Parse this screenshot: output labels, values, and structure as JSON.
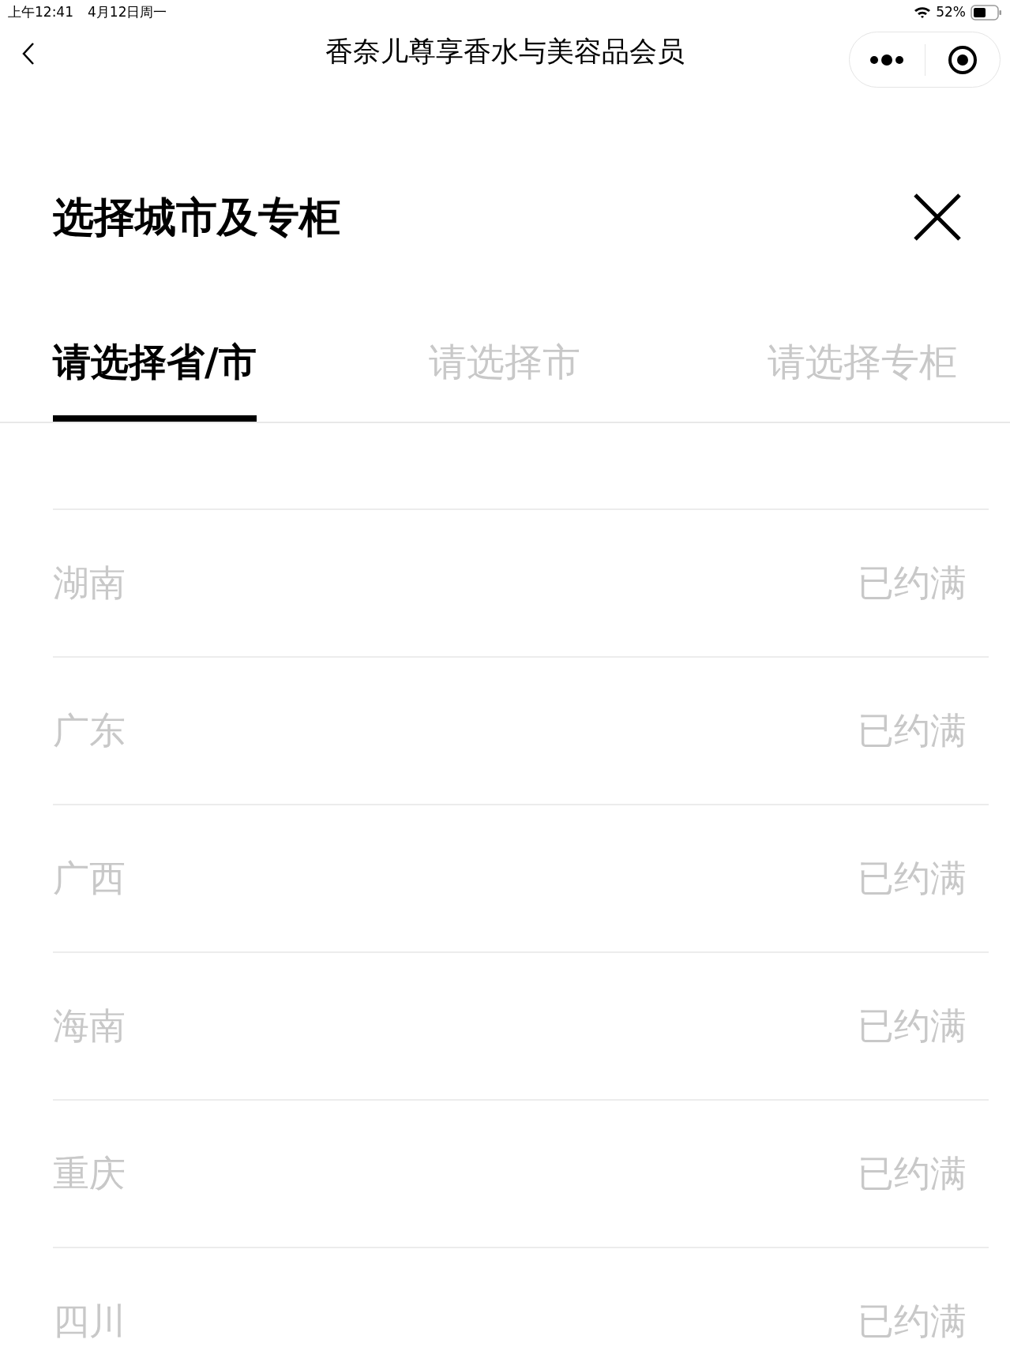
{
  "status_bar": {
    "time": "上午12:41",
    "date": "4月12日周一",
    "battery": "52%"
  },
  "nav": {
    "title": "香奈儿尊享香水与美容品会员"
  },
  "panel": {
    "title": "选择城市及专柜"
  },
  "tabs": [
    {
      "label": "请选择省/市",
      "selected": true
    },
    {
      "label": "请选择市",
      "selected": false
    },
    {
      "label": "请选择专柜",
      "selected": false
    }
  ],
  "provinces": [
    {
      "name": "湖南",
      "status": "已约满",
      "disabled": true
    },
    {
      "name": "广东",
      "status": "已约满",
      "disabled": true
    },
    {
      "name": "广西",
      "status": "已约满",
      "disabled": true
    },
    {
      "name": "海南",
      "status": "已约满",
      "disabled": true
    },
    {
      "name": "重庆",
      "status": "已约满",
      "disabled": true
    },
    {
      "name": "四川",
      "status": "已约满",
      "disabled": true
    }
  ]
}
